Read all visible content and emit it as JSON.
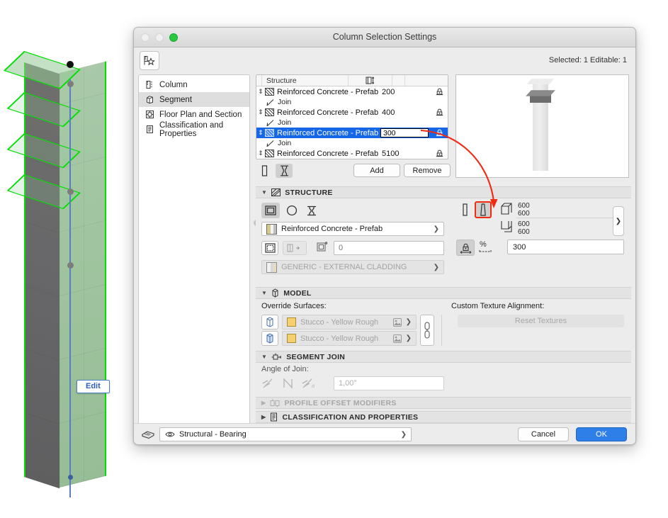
{
  "window": {
    "title": "Column Selection Settings",
    "traffic_lights": [
      "close-red",
      "minimize-yellow",
      "zoom-green"
    ],
    "favorites_icon": "favorites-star-icon",
    "selection_info": "Selected: 1 Editable: 1"
  },
  "sidebar": {
    "items": [
      {
        "label": "Column",
        "icon": "column-icon",
        "selected": false
      },
      {
        "label": "Segment",
        "icon": "segment-icon",
        "selected": true
      },
      {
        "label": "Floor Plan and Section",
        "icon": "floor-plan-icon",
        "selected": false
      },
      {
        "label": "Classification and Properties",
        "icon": "classification-icon",
        "selected": false
      }
    ]
  },
  "segment_list": {
    "columns": [
      "",
      "Structure",
      "thickness-icon",
      "",
      ""
    ],
    "rows": [
      {
        "type": "segment",
        "name": "Reinforced Concrete - Prefab",
        "value": "200",
        "selected": false,
        "editing": false,
        "lock_icon": "lock-icon"
      },
      {
        "type": "join",
        "name": "Join",
        "icon": "join-angle-icon"
      },
      {
        "type": "segment",
        "name": "Reinforced Concrete - Prefab",
        "value": "400",
        "selected": false,
        "editing": false,
        "lock_icon": "lock-icon"
      },
      {
        "type": "join",
        "name": "Join",
        "icon": "join-angle-icon"
      },
      {
        "type": "segment",
        "name": "Reinforced Concrete - Prefab",
        "value": "300",
        "selected": true,
        "editing": true,
        "lock_icon": "lock-icon"
      },
      {
        "type": "join",
        "name": "Join",
        "icon": "join-angle-icon"
      },
      {
        "type": "segment",
        "name": "Reinforced Concrete - Prefab",
        "value": "5100",
        "selected": false,
        "editing": false,
        "lock_icon": "lock-icon"
      }
    ],
    "toolbar": {
      "simple_icon": "simple-column-icon",
      "complex_icon": "complex-column-icon",
      "complex_active": true,
      "add_label": "Add",
      "remove_label": "Remove"
    }
  },
  "preview": {
    "name": "segment-3d-preview"
  },
  "structure": {
    "header": "STRUCTURE",
    "header_icon": "hatch-icon",
    "shapes": [
      {
        "name": "rectangular-shape",
        "active": true
      },
      {
        "name": "circular-shape",
        "active": false
      },
      {
        "name": "profile-shape",
        "active": false
      }
    ],
    "material_value": "Reinforced Concrete - Prefab",
    "veneer_toggle_icon": "veneer-outline-icon",
    "veneer_side_icon": "veneer-side-icon",
    "veneer_thickness_icon": "veneer-thickness-icon",
    "veneer_thickness_value": "0",
    "veneer_material": "GENERIC - EXTERNAL CLADDING",
    "segment_shape_buttons": [
      {
        "name": "straight-segment-icon",
        "active": false
      },
      {
        "name": "tapered-segment-icon",
        "active": true,
        "highlighted": true
      }
    ],
    "top_icon": "top-dimension-icon",
    "bottom_icon": "bottom-dimension-icon",
    "top_dims": [
      "600",
      "600"
    ],
    "bottom_dims": [
      "600",
      "600"
    ],
    "more_arrow": "more-arrow-icon",
    "lock_proportions_icon": "lock-proportions-icon",
    "percent_icon": "percent-icon",
    "segment_length_value": "300"
  },
  "model": {
    "header": "MODEL",
    "header_icon": "model-cube-icon",
    "override_label": "Override Surfaces:",
    "surfaces": [
      {
        "icon": "surface-side-icon",
        "value": "Stucco - Yellow Rough",
        "picker_icon": "material-picker-icon"
      },
      {
        "icon": "surface-end-icon",
        "value": "Stucco - Yellow Rough",
        "picker_icon": "material-picker-icon"
      }
    ],
    "link_icon": "link-surfaces-icon",
    "texture_label": "Custom Texture Alignment:",
    "reset_textures_label": "Reset Textures"
  },
  "segment_join": {
    "header": "SEGMENT JOIN",
    "header_icon": "segment-join-icon",
    "angle_label": "Angle of Join:",
    "angle_modes": [
      "join-perpendicular-icon",
      "join-vertical-icon",
      "join-custom-icon"
    ],
    "angle_value": "1,00°"
  },
  "collapsed_sections": [
    {
      "header": "PROFILE OFFSET MODIFIERS",
      "icon": "profile-offset-icon",
      "dim": true
    },
    {
      "header": "CLASSIFICATION AND PROPERTIES",
      "icon": "classification-icon",
      "dim": false
    }
  ],
  "footer": {
    "layer_icon": "layers-icon",
    "eye_icon": "eye-icon",
    "layer_value": "Structural - Bearing",
    "cancel_label": "Cancel",
    "ok_label": "OK"
  },
  "viewport": {
    "edit_tooltip": "Edit",
    "name": "3d-column-viewport"
  },
  "colors": {
    "accent_blue": "#1667e8",
    "ok_blue": "#2f7fe8",
    "highlight_red": "#f02b12",
    "selection_green": "#00e000",
    "window_bg": "#ececec"
  }
}
